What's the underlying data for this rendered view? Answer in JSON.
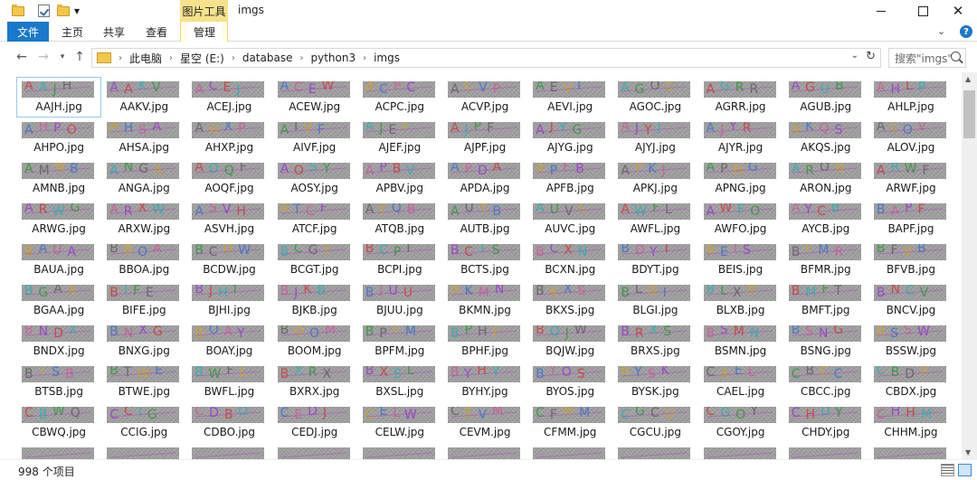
{
  "titlebar": {
    "context_tab": "图片工具",
    "title": "imgs",
    "close_glyph": "✕"
  },
  "ribbon": {
    "tabs": [
      "文件",
      "主页",
      "共享",
      "查看",
      "管理"
    ]
  },
  "address": {
    "crumbs": [
      "此电脑",
      "星空 (E:)",
      "database",
      "python3",
      "imgs"
    ],
    "separator": "›"
  },
  "search": {
    "placeholder": "搜索\"imgs\""
  },
  "files": [
    "AAJH.jpg",
    "AAKV.jpg",
    "ACEJ.jpg",
    "ACEW.jpg",
    "ACPC.jpg",
    "ACVP.jpg",
    "AEVI.jpg",
    "AGOC.jpg",
    "AGRR.jpg",
    "AGUB.jpg",
    "AHLP.jpg",
    "AHPO.jpg",
    "AHSA.jpg",
    "AHXP.jpg",
    "AIVF.jpg",
    "AJEF.jpg",
    "AJPF.jpg",
    "AJYG.jpg",
    "AJYJ.jpg",
    "AJYR.jpg",
    "AKQS.jpg",
    "ALOV.jpg",
    "AMNB.jpg",
    "ANGA.jpg",
    "AOQF.jpg",
    "AOSY.jpg",
    "APBV.jpg",
    "APDA.jpg",
    "APFB.jpg",
    "APKJ.jpg",
    "APNG.jpg",
    "ARON.jpg",
    "ARWF.jpg",
    "ARWG.jpg",
    "ARXW.jpg",
    "ASVH.jpg",
    "ATCF.jpg",
    "ATQB.jpg",
    "AUTB.jpg",
    "AUVC.jpg",
    "AWFL.jpg",
    "AWFO.jpg",
    "AYCB.jpg",
    "BAPF.jpg",
    "BAUA.jpg",
    "BBOA.jpg",
    "BCDW.jpg",
    "BCGT.jpg",
    "BCPI.jpg",
    "BCTS.jpg",
    "BCXN.jpg",
    "BDYT.jpg",
    "BEIS.jpg",
    "BFMR.jpg",
    "BFVB.jpg",
    "BGAA.jpg",
    "BIFE.jpg",
    "BJHI.jpg",
    "BJKB.jpg",
    "BJUU.jpg",
    "BKMN.jpg",
    "BKXS.jpg",
    "BLGI.jpg",
    "BLXB.jpg",
    "BMFT.jpg",
    "BNCV.jpg",
    "BNDX.jpg",
    "BNXG.jpg",
    "BOAY.jpg",
    "BOOM.jpg",
    "BPFM.jpg",
    "BPHF.jpg",
    "BQJW.jpg",
    "BRXS.jpg",
    "BSMN.jpg",
    "BSNG.jpg",
    "BSSW.jpg",
    "BTSB.jpg",
    "BTWE.jpg",
    "BWFL.jpg",
    "BXRX.jpg",
    "BXSL.jpg",
    "BYHY.jpg",
    "BYOS.jpg",
    "BYSK.jpg",
    "CAEL.jpg",
    "CBCC.jpg",
    "CBDX.jpg",
    "CBWQ.jpg",
    "CCIG.jpg",
    "CDBO.jpg",
    "CEDJ.jpg",
    "CELW.jpg",
    "CEVM.jpg",
    "CFMM.jpg",
    "CGCU.jpg",
    "CGOY.jpg",
    "CHDY.jpg",
    "CHHM.jpg"
  ],
  "partial_row_count": 11,
  "status": {
    "count": "998 个项目"
  },
  "colors": {
    "accent": "#1979ca",
    "context_tab": "#f5e28a"
  }
}
